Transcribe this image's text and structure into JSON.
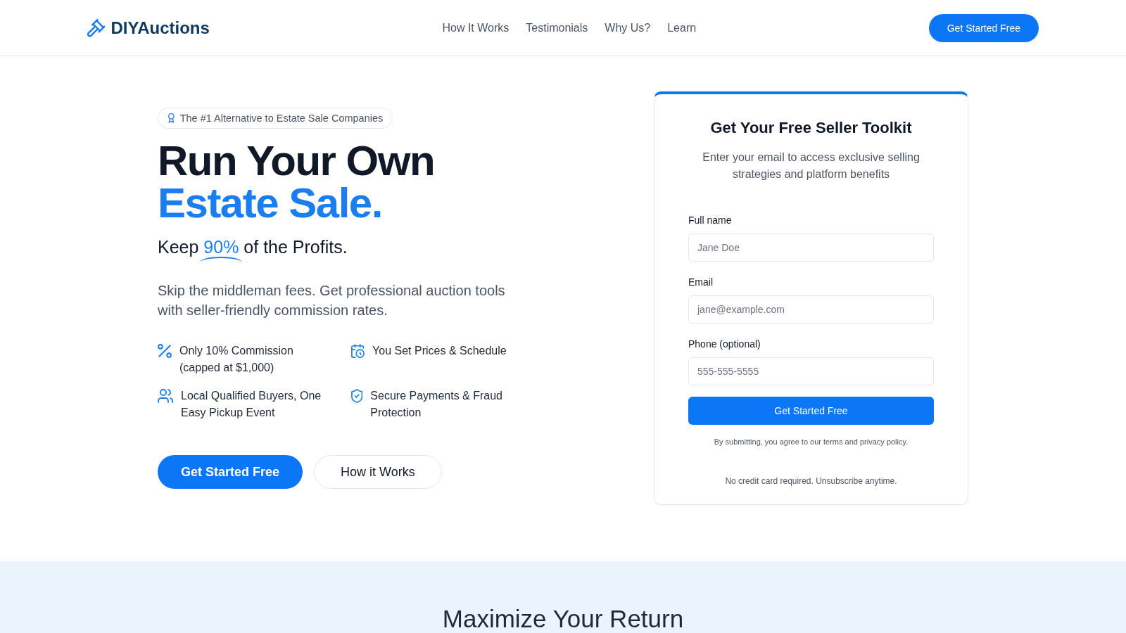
{
  "header": {
    "logo": "DIYAuctions",
    "nav": [
      {
        "label": "How It Works"
      },
      {
        "label": "Testimonials"
      },
      {
        "label": "Why Us?"
      },
      {
        "label": "Learn"
      }
    ],
    "cta": "Get Started Free"
  },
  "hero": {
    "badge": "The #1 Alternative to Estate Sale Companies",
    "headline": [
      {
        "text": "Run Your Own",
        "accent": false
      },
      {
        "text": "Estate Sale.",
        "accent": true
      }
    ],
    "subheadline": [
      {
        "text": "Keep",
        "highlight": false
      },
      {
        "text": "90%",
        "highlight": true
      },
      {
        "text": "of the Profits.",
        "highlight": false
      }
    ],
    "description": "Skip the middleman fees. Get professional auction tools with seller-friendly commission rates.",
    "features": [
      {
        "text": "Only 10% Commission (capped at $1,000)"
      },
      {
        "text": "You Set Prices & Schedule"
      },
      {
        "text": "Local Qualified Buyers, One Easy Pickup Event"
      },
      {
        "text": "Secure Payments & Fraud Protection"
      }
    ],
    "buttons": [
      {
        "kind": "primary",
        "label": "Get Started Free"
      },
      {
        "kind": "secondary",
        "label": "How it Works"
      }
    ]
  },
  "signup_form": {
    "title": "Get Your Free Seller Toolkit",
    "subtitle": "Enter your email to access exclusive selling strategies and platform benefits",
    "fields": [
      {
        "label": "Full name",
        "placeholder": "Jane Doe"
      },
      {
        "label": "Email",
        "placeholder": "jane@example.com"
      },
      {
        "label": "Phone (optional)",
        "placeholder": "555-555-5555"
      }
    ],
    "submit": "Get Started Free",
    "terms": "By submitting, you agree to our terms and privacy policy.",
    "note": "No credit card required. Unsubscribe anytime."
  },
  "next_section": {
    "title": "Maximize Your Return"
  }
}
